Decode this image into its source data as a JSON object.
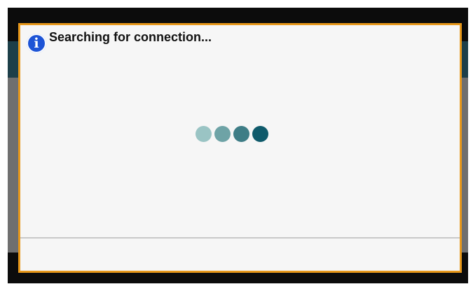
{
  "dialog": {
    "icon": "info-icon",
    "icon_glyph": "i",
    "title": "Searching for connection...",
    "border_color": "#e7981b",
    "background": "#f6f6f6"
  },
  "spinner": {
    "dots": [
      {
        "color": "#9ac4c4"
      },
      {
        "color": "#6ea3a6"
      },
      {
        "color": "#3e7d86"
      },
      {
        "color": "#0f5a6b"
      }
    ]
  },
  "colors": {
    "info_icon": "#1d54d6",
    "header_band": "#1d3f49",
    "overlay": "#6f6f6f"
  }
}
